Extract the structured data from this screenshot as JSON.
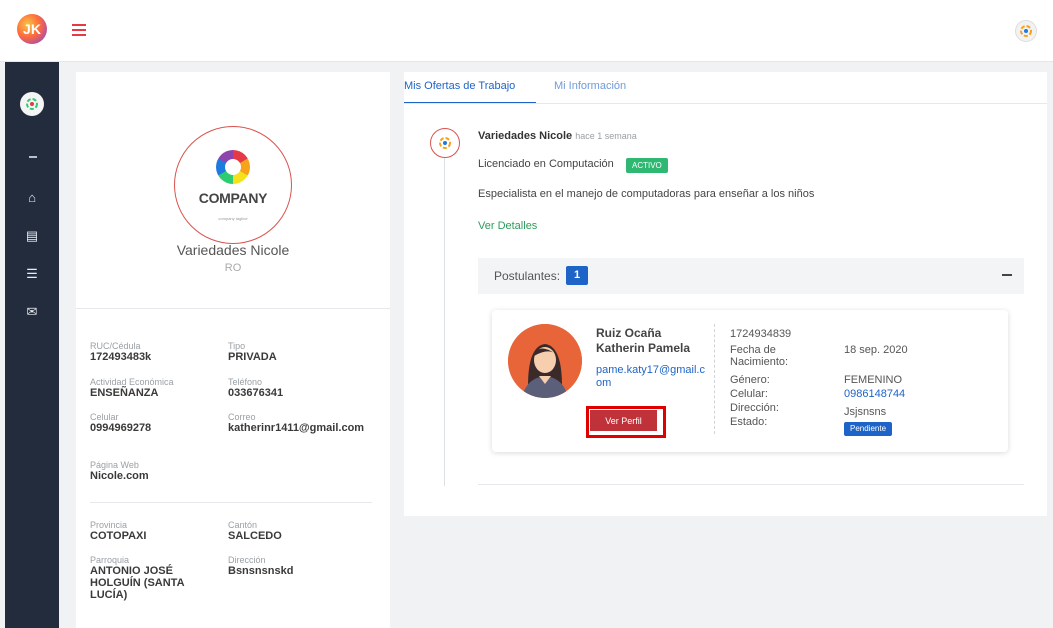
{
  "app": {
    "logo_initials": "JK"
  },
  "colors": {
    "accent": "#1e64c8",
    "danger": "#c0323a",
    "success": "#2eb872",
    "sidebar": "#232c3d"
  },
  "sidebar": {
    "items": [
      {
        "icon": "home-icon",
        "glyph": "⌂"
      },
      {
        "icon": "table-icon",
        "glyph": "▤"
      },
      {
        "icon": "list-icon",
        "glyph": "☰"
      },
      {
        "icon": "feedback-icon",
        "glyph": "✉"
      }
    ]
  },
  "profile": {
    "company_logo_text": "COMPANY",
    "company_logo_tagline": "company tagline",
    "name": "Variedades Nicole",
    "subtitle": "RO",
    "fields": {
      "ruc_label": "RUC/Cédula",
      "ruc_value": "172493483k",
      "tipo_label": "Tipo",
      "tipo_value": "PRIVADA",
      "actividad_label": "Actividad Económica",
      "actividad_value": "ENSEÑANZA",
      "telefono_label": "Teléfono",
      "telefono_value": "033676341",
      "celular_label": "Celular",
      "celular_value": "0994969278",
      "correo_label": "Correo",
      "correo_value": "katherinr1411@gmail.com",
      "web_label": "Página Web",
      "web_value": "Nicole.com",
      "provincia_label": "Provincia",
      "provincia_value": "COTOPAXI",
      "canton_label": "Cantón",
      "canton_value": "SALCEDO",
      "parroquia_label": "Parroquia",
      "parroquia_value": "ANTONIO JOSÉ HOLGUÍN (SANTA LUCÍA)",
      "direccion_label": "Dirección",
      "direccion_value": "Bsnsnsnskd"
    }
  },
  "main": {
    "tabs": [
      {
        "label": "Mis Ofertas de Trabajo"
      },
      {
        "label": "Mi Información"
      }
    ],
    "post": {
      "author": "Variedades Nicole",
      "time": "hace 1 semana",
      "title": "Licenciado en Computación",
      "status": "ACTIVO",
      "description": "Especialista en el manejo de computadoras para enseñar a los niños",
      "details_link": "Ver Detalles"
    },
    "postulantes": {
      "label": "Postulantes:",
      "count": "1"
    },
    "applicant": {
      "name_line1": "Ruiz Ocaña",
      "name_line2": "Katherin Pamela",
      "email": "pame.katy17@gmail.com",
      "view_button": "Ver Perfil",
      "id_number": "1724934839",
      "birth_label_1": "Fecha de",
      "birth_label_2": "Nacimiento:",
      "birth_value": "18 sep. 2020",
      "gender_label": "Género:",
      "gender_value": "FEMENINO",
      "phone_label": "Celular:",
      "phone_value": "0986148744",
      "address_label": "Dirección:",
      "address_value": "Jsjsnsns",
      "state_label": "Estado:",
      "state_value": "Pendiente"
    }
  }
}
